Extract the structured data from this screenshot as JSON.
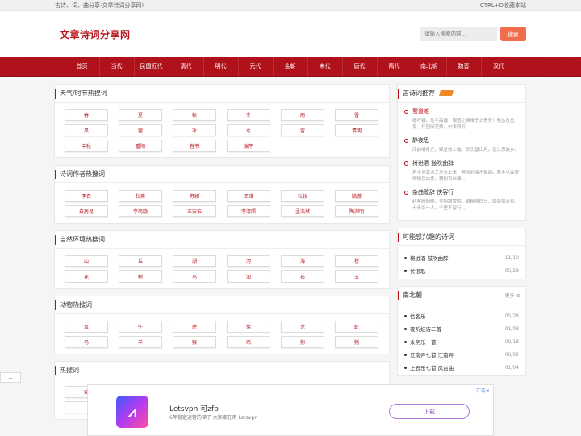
{
  "topbar": {
    "left": "古诗、词、曲分享-文章诗词分享网!",
    "right": "CTRL+D收藏本站"
  },
  "header": {
    "logo": "文章诗词分享网",
    "search_placeholder": "请输入搜索内容...",
    "search_button": "搜索"
  },
  "nav": [
    "首页",
    "当代",
    "民国近代",
    "清代",
    "明代",
    "元代",
    "金朝",
    "宋代",
    "唐代",
    "隋代",
    "南北朝",
    "魏晋",
    "汉代"
  ],
  "panels": [
    {
      "title": "天气/时节热搜词",
      "tags": [
        "春",
        "夏",
        "秋",
        "冬",
        "雨",
        "雪",
        "风",
        "霜",
        "冰",
        "水",
        "雷",
        "清明",
        "中秋",
        "重阳",
        "春节",
        "端午"
      ]
    },
    {
      "title": "诗词作者热搜词",
      "tags": [
        "李白",
        "杜甫",
        "苏轼",
        "王维",
        "杜牧",
        "陆游",
        "白居易",
        "李商隐",
        "王安石",
        "李清照",
        "孟浩然",
        "陶渊明"
      ]
    },
    {
      "title": "自然环境热搜词",
      "tags": [
        "山",
        "丘",
        "湖",
        "河",
        "海",
        "楼",
        "花",
        "树",
        "鸟",
        "泊",
        "石",
        "玉"
      ]
    },
    {
      "title": "动物热搜词",
      "tags": [
        "鼠",
        "牛",
        "虎",
        "兔",
        "龙",
        "蛇",
        "马",
        "羊",
        "猴",
        "鸡",
        "狗",
        "猪"
      ]
    },
    {
      "title": "热搜词",
      "tags": [
        "家",
        "国",
        "院",
        "东",
        "南",
        "西",
        "",
        "",
        "",
        "",
        "",
        ""
      ]
    }
  ],
  "recommend": {
    "title": "古诗词推荐",
    "items": [
      {
        "title": "蜀道难",
        "text": "噫吁嚱，危乎高哉，蜀道之难难于上青天！蚕丛及鱼凫，开国何茫然。尔来四万..."
      },
      {
        "title": "静夜思",
        "text": "床前明月光，疑是地上霜。举头望山月，低头思故乡。"
      },
      {
        "title": "将进酒 鼓吹曲辞",
        "text": "君不见黄河之水天上来，奔流到海不复回。君不见高堂明镜悲白发，朝如青丝暮..."
      },
      {
        "title": "杂曲歌辞 侠客行",
        "text": "赵客缦胡缨，吴钩霜雪明。银鞍照白马，飒沓如流星。十步杀一人，千里不留行..."
      }
    ]
  },
  "interest": {
    "title": "可能感兴趣的诗词",
    "items": [
      {
        "title": "将进酒 鼓吹曲辞",
        "date": "11/10"
      },
      {
        "title": "长恨歌",
        "date": "05/29"
      }
    ]
  },
  "nanbei": {
    "title": "南北朝",
    "more": "更多",
    "items": [
      {
        "title": "估客乐",
        "date": "05/28"
      },
      {
        "title": "夜听妓诗二首",
        "date": "01/03"
      },
      {
        "title": "永明乐十首",
        "date": "09/18"
      },
      {
        "title": "江南弄七首 江南弄",
        "date": "06/02"
      },
      {
        "title": "上云乐七首 凤台曲",
        "date": "01/04"
      }
    ]
  },
  "ad": {
    "title": "Letsvpn 可zfb",
    "sub": "6年稳定运营的梯子 大家都在用 Letsvpn",
    "button": "下载",
    "mark": "广告✕"
  },
  "colors": {
    "brand": "#b5121b",
    "search_button": "#f26d4b"
  }
}
